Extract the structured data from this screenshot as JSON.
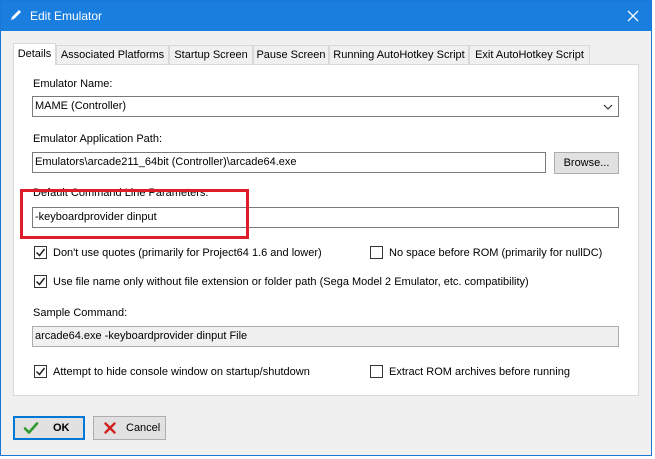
{
  "window": {
    "title": "Edit Emulator"
  },
  "tabs": [
    {
      "label": "Details"
    },
    {
      "label": "Associated Platforms"
    },
    {
      "label": "Startup Screen"
    },
    {
      "label": "Pause Screen"
    },
    {
      "label": "Running AutoHotkey Script"
    },
    {
      "label": "Exit AutoHotkey Script"
    }
  ],
  "details": {
    "emulator_name_label": "Emulator Name:",
    "emulator_name_value": "MAME (Controller)",
    "app_path_label": "Emulator Application Path:",
    "app_path_value": "Emulators\\arcade211_64bit (Controller)\\arcade64.exe",
    "browse_label": "Browse...",
    "cmd_params_label": "Default Command Line Parameters:",
    "cmd_params_value": "-keyboardprovider dinput",
    "checks": [
      {
        "label": "Don't use quotes (primarily for Project64 1.6 and lower)",
        "checked": true
      },
      {
        "label": "No space before ROM (primarily for nullDC)",
        "checked": false
      },
      {
        "label": "Use file name only without file extension or folder path (Sega Model 2 Emulator, etc. compatibility)",
        "checked": true
      }
    ],
    "sample_label": "Sample Command:",
    "sample_value": "arcade64.exe -keyboardprovider dinput File",
    "bottom_checks": [
      {
        "label": "Attempt to hide console window on startup/shutdown",
        "checked": true
      },
      {
        "label": "Extract ROM archives before running",
        "checked": false
      }
    ]
  },
  "buttons": {
    "ok": "OK",
    "cancel": "Cancel"
  },
  "colors": {
    "titlebar": "#1a7ede",
    "highlight": "#e01b2a",
    "ok_check": "#2e9a2e",
    "cancel_x": "#d02020"
  }
}
